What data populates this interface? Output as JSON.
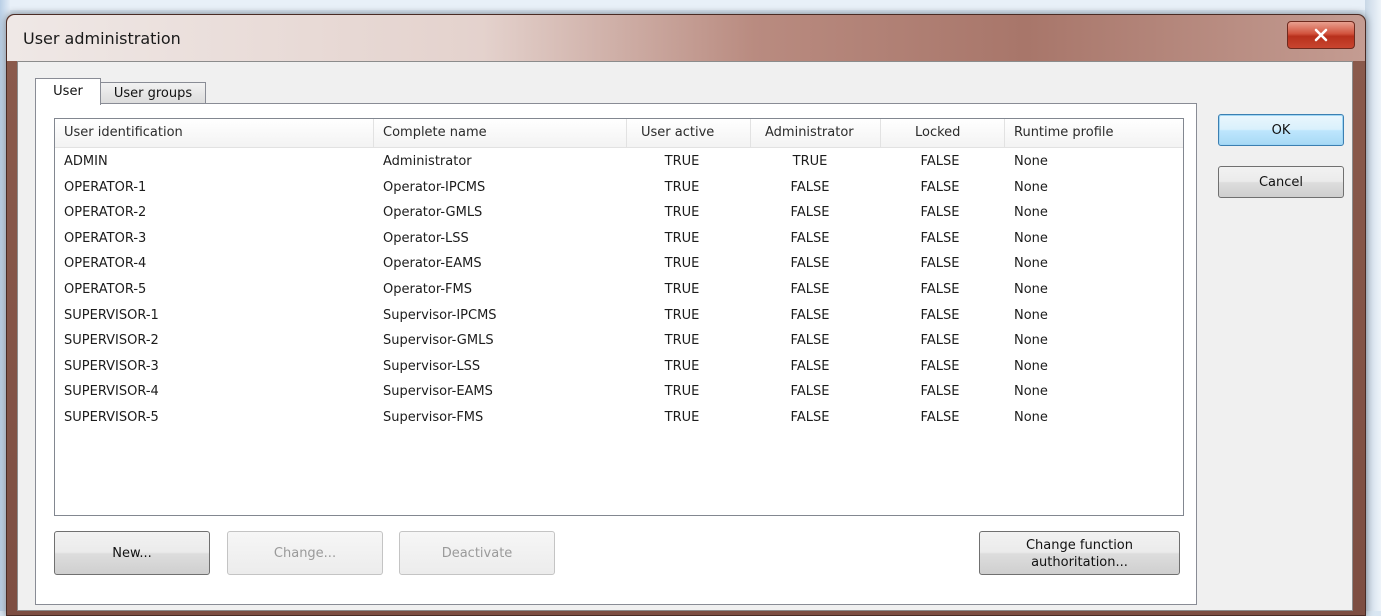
{
  "window": {
    "title": "User administration"
  },
  "tabs": [
    {
      "label": "User",
      "active": true
    },
    {
      "label": "User groups",
      "active": false
    }
  ],
  "table": {
    "columns": [
      "User identification",
      "Complete name",
      "User active",
      "Administrator",
      "Locked",
      "Runtime profile"
    ],
    "rows": [
      {
        "id": "ADMIN",
        "name": "Administrator",
        "active": "TRUE",
        "admin": "TRUE",
        "locked": "FALSE",
        "profile": "None"
      },
      {
        "id": "OPERATOR-1",
        "name": "Operator-IPCMS",
        "active": "TRUE",
        "admin": "FALSE",
        "locked": "FALSE",
        "profile": "None"
      },
      {
        "id": "OPERATOR-2",
        "name": "Operator-GMLS",
        "active": "TRUE",
        "admin": "FALSE",
        "locked": "FALSE",
        "profile": "None"
      },
      {
        "id": "OPERATOR-3",
        "name": "Operator-LSS",
        "active": "TRUE",
        "admin": "FALSE",
        "locked": "FALSE",
        "profile": "None"
      },
      {
        "id": "OPERATOR-4",
        "name": "Operator-EAMS",
        "active": "TRUE",
        "admin": "FALSE",
        "locked": "FALSE",
        "profile": "None"
      },
      {
        "id": "OPERATOR-5",
        "name": "Operator-FMS",
        "active": "TRUE",
        "admin": "FALSE",
        "locked": "FALSE",
        "profile": "None"
      },
      {
        "id": "SUPERVISOR-1",
        "name": "Supervisor-IPCMS",
        "active": "TRUE",
        "admin": "FALSE",
        "locked": "FALSE",
        "profile": "None"
      },
      {
        "id": "SUPERVISOR-2",
        "name": "Supervisor-GMLS",
        "active": "TRUE",
        "admin": "FALSE",
        "locked": "FALSE",
        "profile": "None"
      },
      {
        "id": "SUPERVISOR-3",
        "name": "Supervisor-LSS",
        "active": "TRUE",
        "admin": "FALSE",
        "locked": "FALSE",
        "profile": "None"
      },
      {
        "id": "SUPERVISOR-4",
        "name": "Supervisor-EAMS",
        "active": "TRUE",
        "admin": "FALSE",
        "locked": "FALSE",
        "profile": "None"
      },
      {
        "id": "SUPERVISOR-5",
        "name": "Supervisor-FMS",
        "active": "TRUE",
        "admin": "FALSE",
        "locked": "FALSE",
        "profile": "None"
      }
    ]
  },
  "buttons": {
    "new": "New...",
    "change": "Change...",
    "deactivate": "Deactivate",
    "change_function_line1": "Change function",
    "change_function_line2": "authoritation...",
    "ok": "OK",
    "cancel": "Cancel"
  },
  "icons": {
    "close": "close-icon"
  },
  "colors": {
    "title_bar_accent": "#a8766a",
    "close_button": "#c8452f",
    "ok_button_border": "#3c7fb1"
  }
}
